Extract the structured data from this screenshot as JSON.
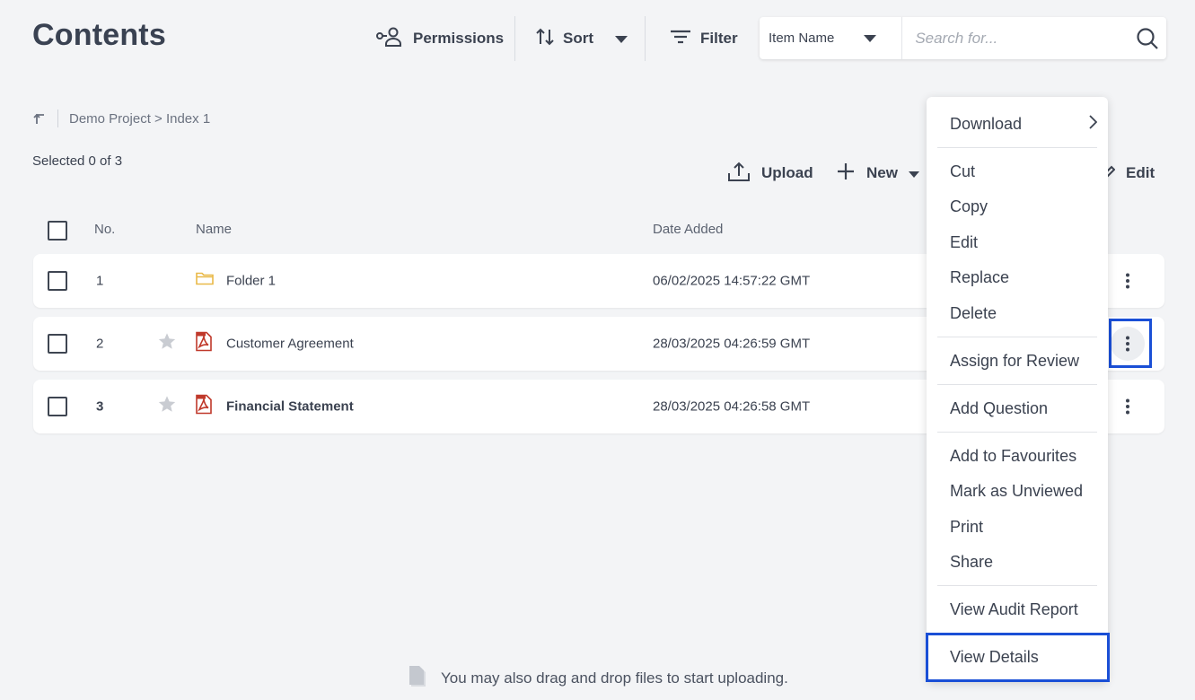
{
  "page": {
    "title": "Contents"
  },
  "toolbar": {
    "permissions_label": "Permissions",
    "sort_label": "Sort",
    "filter_label": "Filter"
  },
  "search": {
    "field_selected": "Item Name",
    "placeholder": "Search for..."
  },
  "breadcrumb": {
    "path": "Demo Project > Index 1"
  },
  "selection": {
    "text": "Selected 0 of 3"
  },
  "actions": {
    "upload_label": "Upload",
    "new_label": "New",
    "edit_label": "Edit"
  },
  "table": {
    "headers": {
      "no": "No.",
      "name": "Name",
      "date": "Date Added"
    },
    "rows": [
      {
        "no": "1",
        "name": "Folder 1",
        "date": "06/02/2025 14:57:22 GMT",
        "type": "folder-icon"
      },
      {
        "no": "2",
        "name": "Customer Agreement",
        "date": "28/03/2025 04:26:59 GMT",
        "type": "pdf-icon"
      },
      {
        "no": "3",
        "name": "Financial Statement",
        "date": "28/03/2025 04:26:58 GMT",
        "type": "pdf-icon"
      }
    ]
  },
  "context_menu": {
    "items": [
      "Download",
      "Cut",
      "Copy",
      "Edit",
      "Replace",
      "Delete",
      "Assign for Review",
      "Add Question",
      "Add to Favourites",
      "Mark as Unviewed",
      "Print",
      "Share",
      "View Audit Report",
      "View Details"
    ]
  },
  "drop_hint": {
    "text": "You may also drag and drop files to start uploading."
  },
  "colors": {
    "accent_highlight": "#1a4fd6",
    "folder": "#e9b949",
    "pdf": "#c0392b",
    "star": "#c9ccd2"
  }
}
